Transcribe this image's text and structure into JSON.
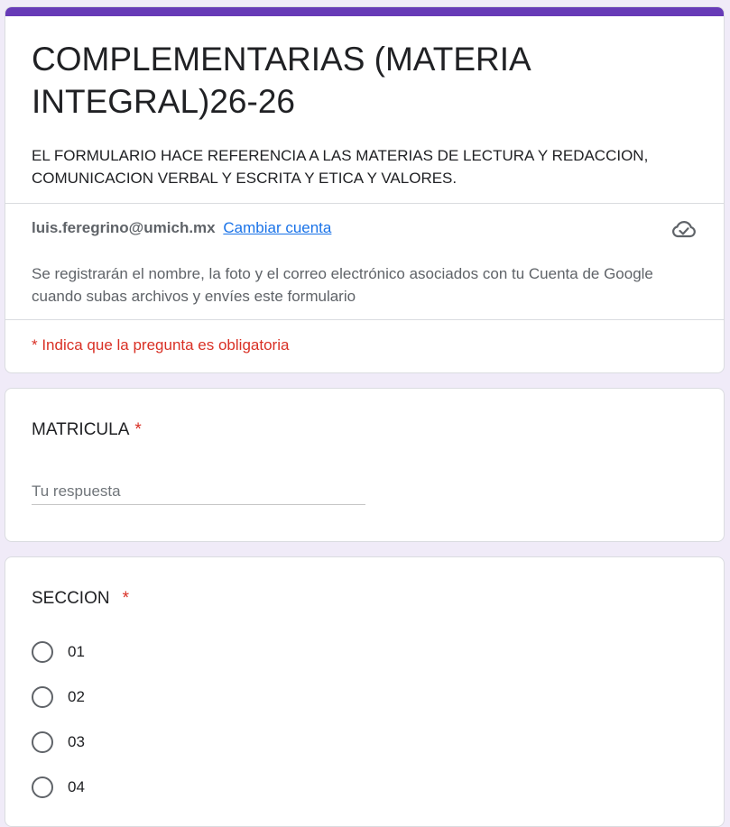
{
  "header": {
    "title": "COMPLEMENTARIAS (MATERIA INTEGRAL)26-26",
    "description": "EL FORMULARIO HACE REFERENCIA A LAS MATERIAS DE LECTURA Y REDACCION, COMUNICACION VERBAL Y ESCRITA Y ETICA Y VALORES.",
    "account_email": "luis.feregrino@umich.mx",
    "switch_account_label": "Cambiar cuenta",
    "privacy_note": "Se registrarán el nombre, la foto y el correo electrónico asociados con tu Cuenta de Google cuando subas archivos y envíes este formulario",
    "required_note": "* Indica que la pregunta es obligatoria",
    "cloud_icon": "cloud-check-icon"
  },
  "questions": [
    {
      "title": "MATRICULA",
      "required_mark": "*",
      "input_placeholder": "Tu respuesta",
      "input_value": ""
    },
    {
      "title": "SECCION",
      "required_mark": "*",
      "options": [
        "01",
        "02",
        "03",
        "04"
      ]
    }
  ],
  "colors": {
    "accent": "#673ab7",
    "background": "#f0ebf8",
    "required": "#d93025",
    "link": "#1a73e8"
  }
}
